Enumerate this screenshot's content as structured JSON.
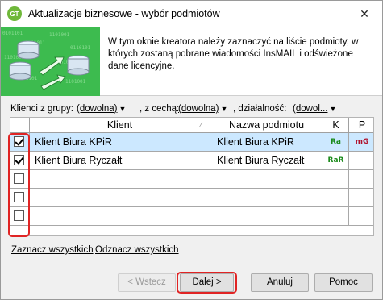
{
  "window": {
    "title": "Aktualizacje biznesowe - wybór podmiotów",
    "icon_text": "GT"
  },
  "banner": {
    "description": "W tym oknie kreatora należy zaznaczyć na liście podmioty, w których zostaną pobrane wiadomości InsMAIL i odświeżone dane licencyjne."
  },
  "filters": {
    "group_label": "Klienci z grupy:",
    "group_value": "(dowolna)",
    "feature_label": ", z cechą:",
    "feature_value": "(dowolna)",
    "activity_label": ", działalność:",
    "activity_value": "(dowol..."
  },
  "grid": {
    "columns": [
      "Klient",
      "Nazwa podmiotu",
      "K",
      "P"
    ],
    "rows": [
      {
        "checked": true,
        "client": "Klient Biura KPiR",
        "entity": "Klient Biura KPiR",
        "k": "Ra",
        "p": "mG",
        "selected": true
      },
      {
        "checked": true,
        "client": "Klient Biura Ryczałt",
        "entity": "Klient Biura Ryczałt",
        "k": "RaR",
        "p": "",
        "selected": false
      },
      {
        "checked": false,
        "client": "",
        "entity": "",
        "k": "",
        "p": "",
        "selected": false
      },
      {
        "checked": false,
        "client": "",
        "entity": "",
        "k": "",
        "p": "",
        "selected": false
      },
      {
        "checked": false,
        "client": "",
        "entity": "",
        "k": "",
        "p": "",
        "selected": false
      }
    ]
  },
  "links": {
    "select_all": "Zaznacz wszystkich",
    "deselect_all": "Odznacz wszystkich"
  },
  "buttons": {
    "back": "< Wstecz",
    "next": "Dalej >",
    "cancel": "Anuluj",
    "help": "Pomoc"
  },
  "colors": {
    "selection": "#cce8ff",
    "highlight": "#e02424",
    "banner_green": "#38b24a",
    "tag_k": "#1a8a1a",
    "tag_p": "#b0102a"
  }
}
